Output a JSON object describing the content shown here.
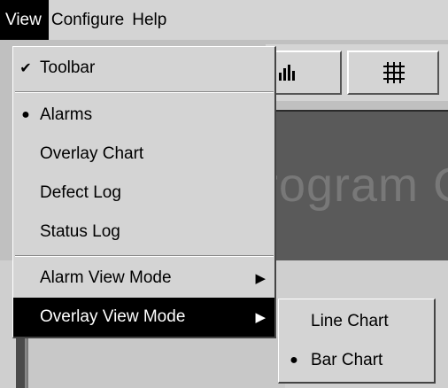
{
  "menubar": {
    "items": [
      {
        "label": "View"
      },
      {
        "label": "Configure"
      },
      {
        "label": "Help"
      }
    ]
  },
  "background": {
    "watermark_text": "rogram C"
  },
  "view_menu": {
    "toolbar": {
      "label": "Toolbar",
      "mark": "✔"
    },
    "alarms": {
      "label": "Alarms",
      "mark": "●"
    },
    "overlay_chart": {
      "label": "Overlay Chart"
    },
    "defect_log": {
      "label": "Defect Log"
    },
    "status_log": {
      "label": "Status Log"
    },
    "alarm_view_mode": {
      "label": "Alarm View Mode",
      "arrow": "▶"
    },
    "overlay_view_mode": {
      "label": "Overlay View Mode",
      "arrow": "▶"
    }
  },
  "overlay_submenu": {
    "line_chart": {
      "label": "Line Chart"
    },
    "bar_chart": {
      "label": "Bar Chart",
      "mark": "●"
    }
  },
  "colors": {
    "menu_bg": "#d4d4d4",
    "highlight_bg": "#000000",
    "highlight_fg": "#ffffff",
    "pane_bg": "#5a5a5a"
  },
  "icons": [
    "bar-chart-icon",
    "grid-icon",
    "checkmark-icon",
    "radio-dot-icon",
    "submenu-arrow-icon"
  ]
}
